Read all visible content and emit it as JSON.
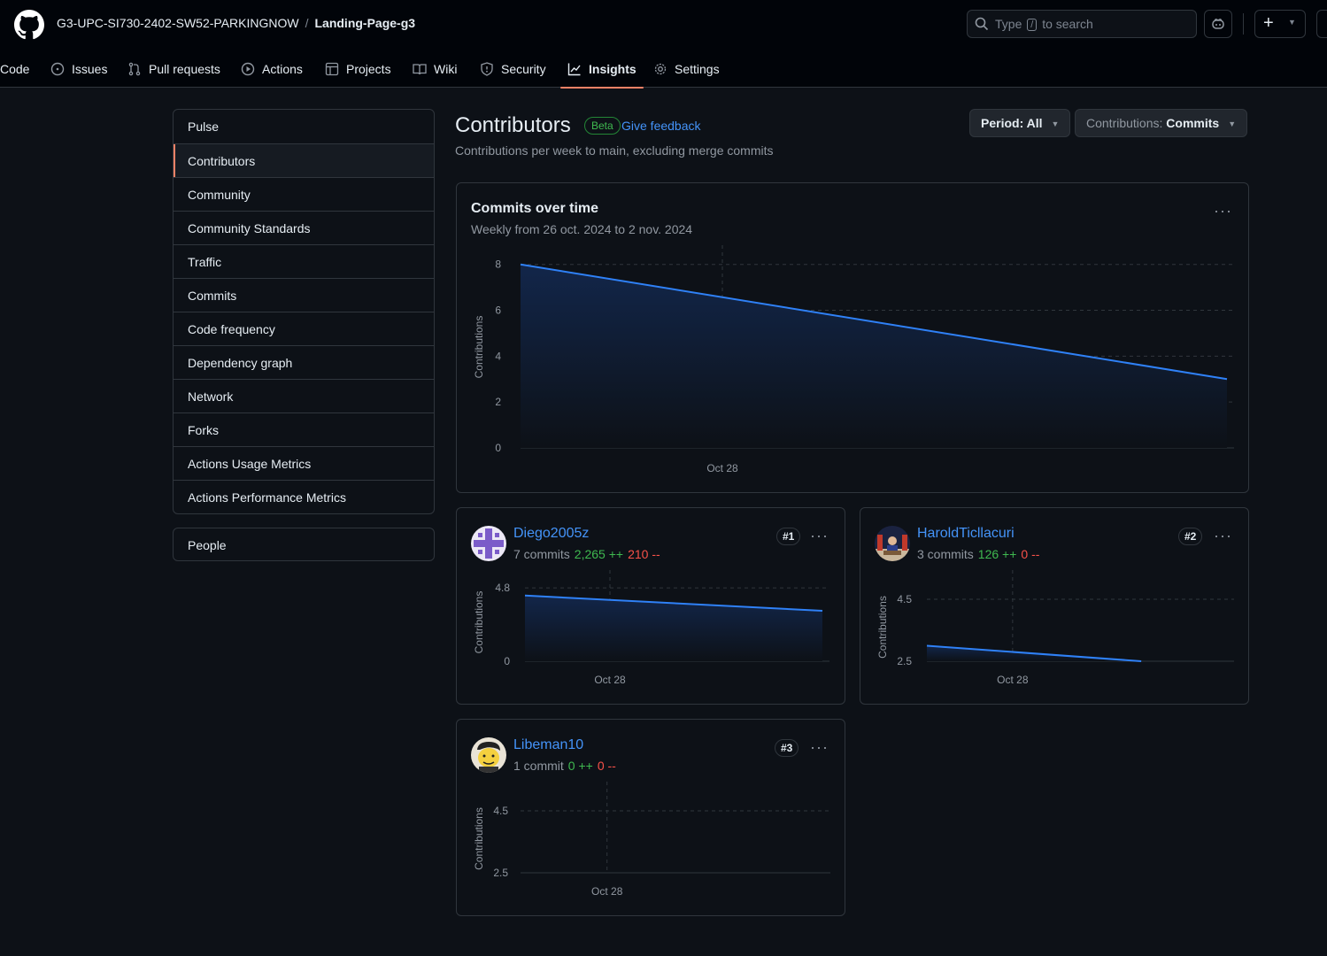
{
  "header": {
    "owner": "G3-UPC-SI730-2402-SW52-PARKINGNOW",
    "separator": "/",
    "repo": "Landing-Page-g3",
    "search_prefix": "Type",
    "search_key": "/",
    "search_suffix": "to search"
  },
  "tabs": [
    {
      "label": "Code",
      "icon": "code-icon"
    },
    {
      "label": "Issues",
      "icon": "issue-icon"
    },
    {
      "label": "Pull requests",
      "icon": "pull-request-icon"
    },
    {
      "label": "Actions",
      "icon": "play-icon"
    },
    {
      "label": "Projects",
      "icon": "table-icon"
    },
    {
      "label": "Wiki",
      "icon": "book-icon"
    },
    {
      "label": "Security",
      "icon": "shield-icon"
    },
    {
      "label": "Insights",
      "icon": "graph-icon",
      "active": true
    },
    {
      "label": "Settings",
      "icon": "gear-icon"
    }
  ],
  "sidebar": {
    "items": [
      "Pulse",
      "Contributors",
      "Community",
      "Community Standards",
      "Traffic",
      "Commits",
      "Code frequency",
      "Dependency graph",
      "Network",
      "Forks",
      "Actions Usage Metrics",
      "Actions Performance Metrics"
    ],
    "selected": "Contributors",
    "people": "People"
  },
  "page": {
    "title": "Contributors",
    "badge": "Beta",
    "feedback": "Give feedback",
    "subtitle": "Contributions per week to main, excluding merge commits",
    "period_label": "Period: All",
    "contrib_prefix": "Contributions:",
    "contrib_value": "Commits"
  },
  "overview": {
    "title": "Commits over time",
    "subtitle": "Weekly from 26 oct. 2024 to 2 nov. 2024",
    "more": "···"
  },
  "contributors": [
    {
      "name": "Diego2005z",
      "commits": "7 commits",
      "additions": "2,265 ++",
      "deletions": "210 --",
      "rank": "#1",
      "more": "···"
    },
    {
      "name": "HaroldTicllacuri",
      "commits": "3 commits",
      "additions": "126 ++",
      "deletions": "0 --",
      "rank": "#2",
      "more": "···"
    },
    {
      "name": "Libeman10",
      "commits": "1 commit",
      "additions": "0 ++",
      "deletions": "0 --",
      "rank": "#3",
      "more": "···"
    }
  ],
  "colors": {
    "accent": "#f78166",
    "link": "#4493f8",
    "line": "#2f81f7",
    "add": "#3fb950",
    "del": "#f85149"
  },
  "chart_data": [
    {
      "type": "area",
      "title": "Commits over time",
      "ylabel": "Contributions",
      "x": [
        "2024-10-26",
        "2024-11-02"
      ],
      "y": [
        8,
        3
      ],
      "x_ticks": [
        "Oct 28"
      ],
      "y_ticks": [
        0,
        2,
        4,
        6,
        8
      ],
      "ylim": [
        0,
        8.8
      ],
      "grid": true
    },
    {
      "type": "area",
      "series": [
        {
          "name": "Diego2005z",
          "values": [
            4.3,
            3.3
          ]
        }
      ],
      "ylabel": "Contributions",
      "x": [
        "2024-10-26",
        "2024-11-02"
      ],
      "x_ticks": [
        "Oct 28"
      ],
      "y_ticks": [
        0,
        4.8
      ],
      "ylim": [
        0,
        5.1
      ]
    },
    {
      "type": "area",
      "series": [
        {
          "name": "HaroldTicllacuri",
          "values": [
            3,
            2.5
          ]
        }
      ],
      "ylabel": "Contributions",
      "x": [
        "2024-10-26",
        "2024-10-31"
      ],
      "x_ticks": [
        "Oct 28"
      ],
      "y_ticks": [
        2.5,
        4.5
      ],
      "ylim": [
        2.5,
        4.7
      ]
    },
    {
      "type": "area",
      "series": [
        {
          "name": "Libeman10",
          "values": []
        }
      ],
      "ylabel": "Contributions",
      "x_ticks": [
        "Oct 28"
      ],
      "y_ticks": [
        2.5,
        4.5
      ],
      "ylim": [
        2.5,
        4.7
      ]
    }
  ]
}
